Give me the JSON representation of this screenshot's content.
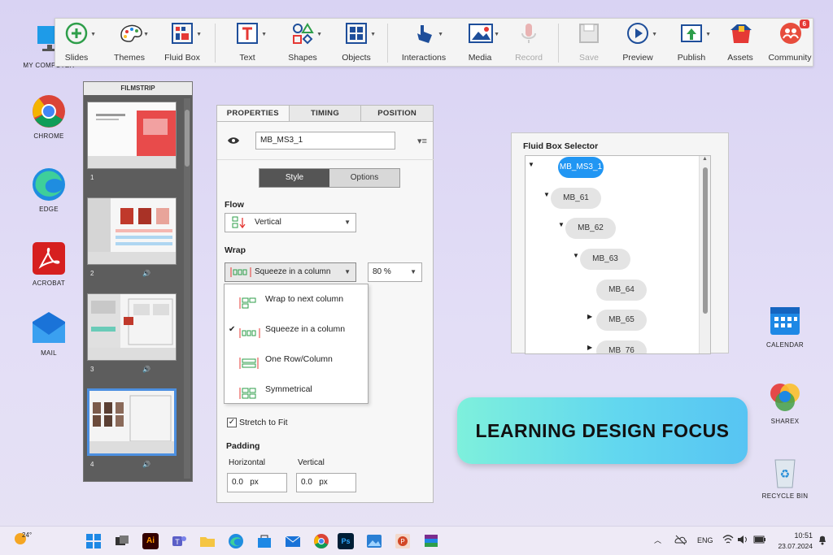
{
  "desktop": {
    "left_icons": [
      {
        "label": "MY COMPUTER",
        "icon": "monitor-icon"
      },
      {
        "label": "CHROME",
        "icon": "chrome-icon"
      },
      {
        "label": "EDGE",
        "icon": "edge-icon"
      },
      {
        "label": "ACROBAT",
        "icon": "acrobat-icon"
      },
      {
        "label": "MAIL",
        "icon": "mail-icon"
      }
    ],
    "right_icons": [
      {
        "label": "CALENDAR",
        "icon": "calendar-icon"
      },
      {
        "label": "SHAREX",
        "icon": "sharex-icon"
      },
      {
        "label": "RECYCLE BIN",
        "icon": "recycle-bin-icon"
      }
    ]
  },
  "toolbar": {
    "items": [
      {
        "label": "Slides",
        "icon": "slides-icon"
      },
      {
        "label": "Themes",
        "icon": "themes-icon"
      },
      {
        "label": "Fluid Box",
        "icon": "fluid-box-icon"
      },
      {
        "label": "Text",
        "icon": "text-icon"
      },
      {
        "label": "Shapes",
        "icon": "shapes-icon"
      },
      {
        "label": "Objects",
        "icon": "objects-icon"
      },
      {
        "label": "Interactions",
        "icon": "interactions-icon"
      },
      {
        "label": "Media",
        "icon": "media-icon"
      },
      {
        "label": "Record",
        "icon": "microphone-icon"
      },
      {
        "label": "Save",
        "icon": "save-icon"
      },
      {
        "label": "Preview",
        "icon": "preview-icon"
      },
      {
        "label": "Publish",
        "icon": "publish-icon"
      },
      {
        "label": "Assets",
        "icon": "assets-icon"
      },
      {
        "label": "Community",
        "icon": "community-icon"
      }
    ],
    "community_badge": "6"
  },
  "filmstrip": {
    "title": "FILMSTRIP",
    "slides": [
      {
        "number": "1"
      },
      {
        "number": "2"
      },
      {
        "number": "3"
      },
      {
        "number": "4"
      }
    ],
    "audio_glyph": "🔊"
  },
  "properties": {
    "tabs": [
      "PROPERTIES",
      "TIMING",
      "POSITION"
    ],
    "name_value": "MB_MS3_1",
    "subtabs": [
      "Style",
      "Options"
    ],
    "flow_label": "Flow",
    "flow_value": "Vertical",
    "wrap_label": "Wrap",
    "wrap_value": "Squeeze in a column",
    "wrap_percent": "80 %",
    "wrap_options": [
      "Wrap to next column",
      "Squeeze in a column",
      "One Row/Column",
      "Symmetrical"
    ],
    "stretch_label": "Stretch to Fit",
    "padding_label": "Padding",
    "horizontal_label": "Horizontal",
    "vertical_label": "Vertical",
    "horizontal_value": "0.0",
    "vertical_value": "0.0",
    "unit": "px"
  },
  "fluid_box": {
    "title": "Fluid Box Selector",
    "nodes": [
      "MB_MS3_1",
      "MB_61",
      "MB_62",
      "MB_63",
      "MB_64",
      "MB_65",
      "MB_76"
    ]
  },
  "banner": {
    "text": "LEARNING DESIGN FOCUS"
  },
  "taskbar": {
    "weather": "24°",
    "language": "ENG",
    "time": "10:51",
    "date": "23.07.2024"
  },
  "colors": {
    "accent": "#2196f3",
    "banner_start": "#7ef0dc",
    "banner_end": "#57c4f3"
  }
}
